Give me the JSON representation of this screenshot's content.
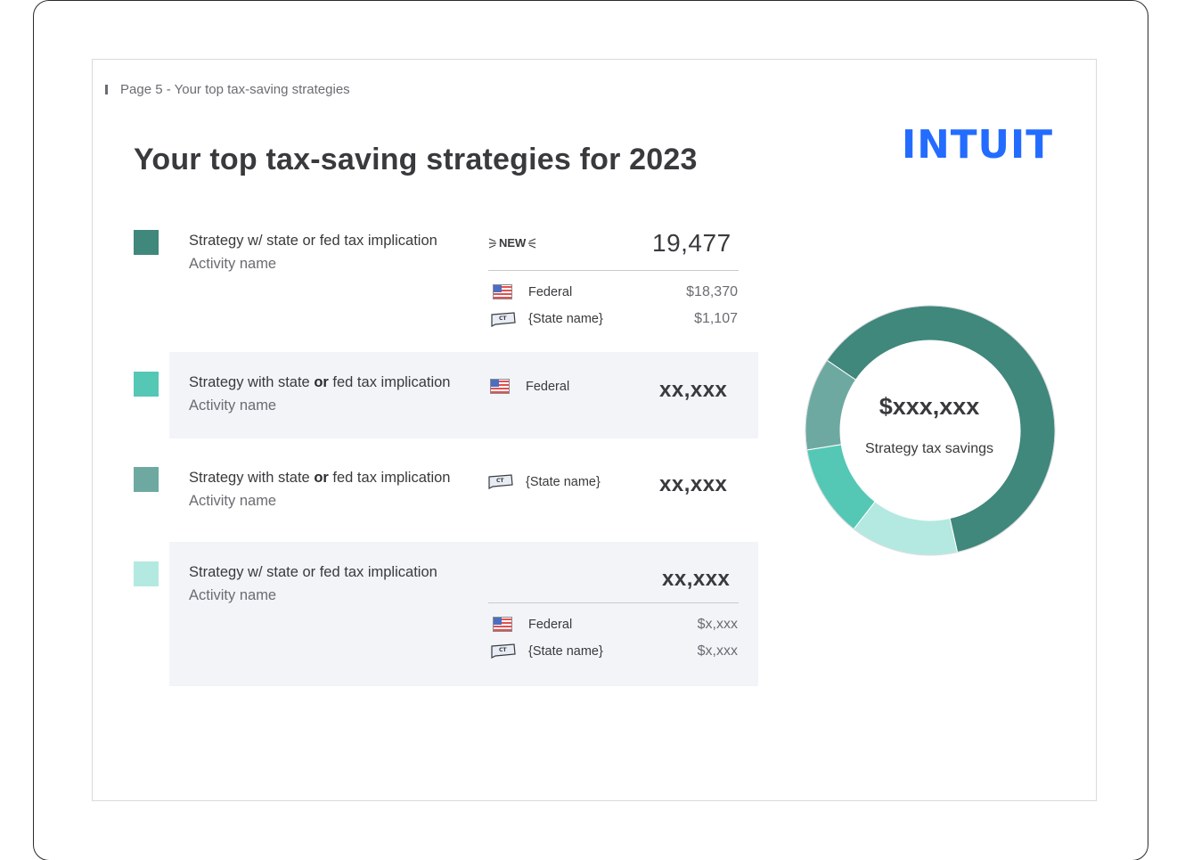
{
  "breadcrumb": "Page 5 - Your top tax-saving strategies",
  "title": "Your top tax-saving strategies for 2023",
  "logo": "INTUIT",
  "colors": {
    "brand_blue": "#236cff",
    "strategy_1": "#40877c",
    "strategy_2": "#55c7b5",
    "strategy_3": "#6ea9a1",
    "strategy_4": "#b3e9e1",
    "row_highlight": "#f3f4f8"
  },
  "strategies": [
    {
      "title_pre": "Strategy w/ state or fed tax implication",
      "title_bold": "",
      "title_post": "",
      "activity": "Activity name",
      "badge": "NEW",
      "total": "19,477",
      "breakdown": [
        {
          "icon": "us-flag-icon",
          "name": "Federal",
          "amount": "$18,370"
        },
        {
          "icon": "ct-state-icon",
          "state_code": "CT",
          "name": "{State name}",
          "amount": "$1,107"
        }
      ]
    },
    {
      "title_pre": "Strategy with state ",
      "title_bold": "or",
      "title_post": " fed tax implication",
      "activity": "Activity name",
      "jurisdiction": {
        "icon": "us-flag-icon",
        "name": "Federal"
      },
      "total": "xx,xxx"
    },
    {
      "title_pre": "Strategy with state ",
      "title_bold": "or",
      "title_post": " fed tax implication",
      "activity": "Activity name",
      "jurisdiction": {
        "icon": "ct-state-icon",
        "state_code": "CT",
        "name": "{State name}"
      },
      "total": "xx,xxx"
    },
    {
      "title_pre": "Strategy w/ state or fed tax implication",
      "title_bold": "",
      "title_post": "",
      "activity": "Activity name",
      "total": "xx,xxx",
      "breakdown": [
        {
          "icon": "us-flag-icon",
          "name": "Federal",
          "amount": "$x,xxx"
        },
        {
          "icon": "ct-state-icon",
          "state_code": "CT",
          "name": "{State name}",
          "amount": "$x,xxx"
        }
      ]
    }
  ],
  "donut": {
    "value": "$xxx,xxx",
    "label": "Strategy tax savings",
    "segment_shares": [
      0.62,
      0.14,
      0.12,
      0.12
    ]
  }
}
